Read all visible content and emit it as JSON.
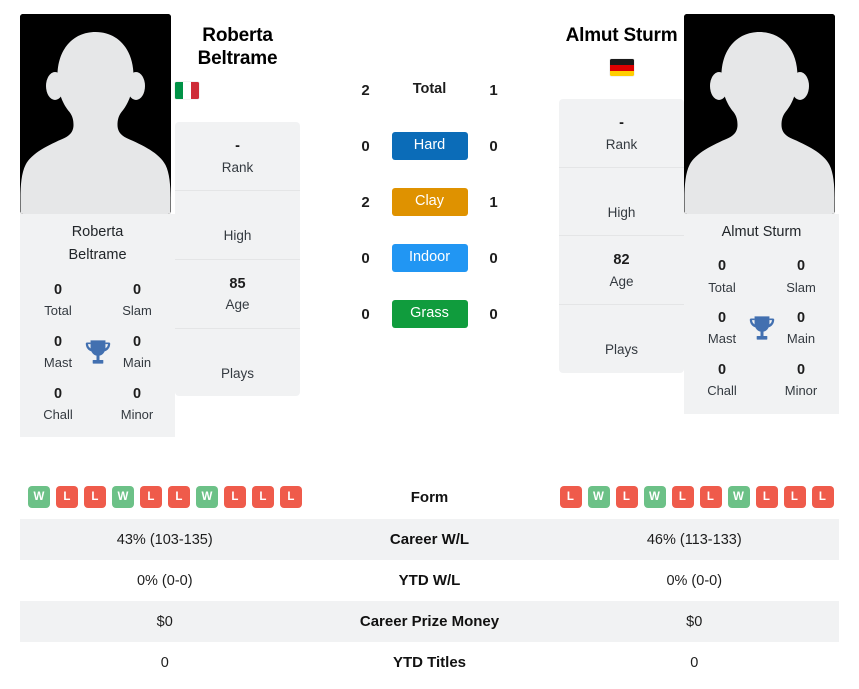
{
  "players": {
    "left": {
      "name": "Roberta Beltrame",
      "name_line1": "Roberta",
      "name_line2": "Beltrame",
      "country": "Italy",
      "flag_icon": "flag-italy-icon",
      "flag_colors": [
        "#009246",
        "#ffffff",
        "#ce2b37"
      ],
      "photo_caption": "Roberta Beltrame",
      "info": [
        {
          "value": "-",
          "label": "Rank"
        },
        {
          "value": "",
          "label": "High"
        },
        {
          "value": "85",
          "label": "Age"
        },
        {
          "value": "",
          "label": "Plays"
        }
      ],
      "titles": [
        {
          "value": "0",
          "label": "Total"
        },
        {
          "value": "0",
          "label": "Slam"
        },
        {
          "value": "0",
          "label": "Mast"
        },
        {
          "value": "0",
          "label": "Main"
        },
        {
          "value": "0",
          "label": "Chall"
        },
        {
          "value": "0",
          "label": "Minor"
        }
      ],
      "form": [
        "W",
        "L",
        "L",
        "W",
        "L",
        "L",
        "W",
        "L",
        "L",
        "L"
      ],
      "career_wl": "43% (103-135)",
      "ytd_wl": "0% (0-0)",
      "career_prize": "$0",
      "ytd_titles": "0"
    },
    "right": {
      "name": "Almut Sturm",
      "name_line1": "Almut Sturm",
      "name_line2": "",
      "country": "Germany",
      "flag_icon": "flag-germany-icon",
      "flag_colors": [
        "#1a1a1a",
        "#dd0000",
        "#ffce00"
      ],
      "photo_caption": "Almut Sturm",
      "info": [
        {
          "value": "-",
          "label": "Rank"
        },
        {
          "value": "",
          "label": "High"
        },
        {
          "value": "82",
          "label": "Age"
        },
        {
          "value": "",
          "label": "Plays"
        }
      ],
      "titles": [
        {
          "value": "0",
          "label": "Total"
        },
        {
          "value": "0",
          "label": "Slam"
        },
        {
          "value": "0",
          "label": "Mast"
        },
        {
          "value": "0",
          "label": "Main"
        },
        {
          "value": "0",
          "label": "Chall"
        },
        {
          "value": "0",
          "label": "Minor"
        }
      ],
      "form": [
        "L",
        "W",
        "L",
        "W",
        "L",
        "L",
        "W",
        "L",
        "L",
        "L"
      ],
      "career_wl": "46% (113-133)",
      "ytd_wl": "0% (0-0)",
      "career_prize": "$0",
      "ytd_titles": "0"
    }
  },
  "h2h": {
    "rows": [
      {
        "left": "2",
        "label": "Total",
        "right": "1",
        "style": "plain",
        "color": ""
      },
      {
        "left": "0",
        "label": "Hard",
        "right": "0",
        "style": "badge",
        "color": "#0b6cb8"
      },
      {
        "left": "2",
        "label": "Clay",
        "right": "1",
        "style": "badge",
        "color": "#df9200"
      },
      {
        "left": "0",
        "label": "Indoor",
        "right": "0",
        "style": "badge",
        "color": "#2196f3"
      },
      {
        "left": "0",
        "label": "Grass",
        "right": "0",
        "style": "badge",
        "color": "#109c3d"
      }
    ]
  },
  "comparison": {
    "rows": [
      {
        "label": "Form",
        "type": "form"
      },
      {
        "label": "Career W/L",
        "type": "text",
        "left": "43% (103-135)",
        "right": "46% (113-133)"
      },
      {
        "label": "YTD W/L",
        "type": "text",
        "left": "0% (0-0)",
        "right": "0% (0-0)"
      },
      {
        "label": "Career Prize Money",
        "type": "text",
        "left": "$0",
        "right": "$0"
      },
      {
        "label": "YTD Titles",
        "type": "text",
        "left": "0",
        "right": "0"
      }
    ]
  },
  "colors": {
    "win": "#6cc187",
    "loss": "#ef5b4b",
    "trophy": "#4270b0",
    "panel": "#f1f2f3"
  }
}
